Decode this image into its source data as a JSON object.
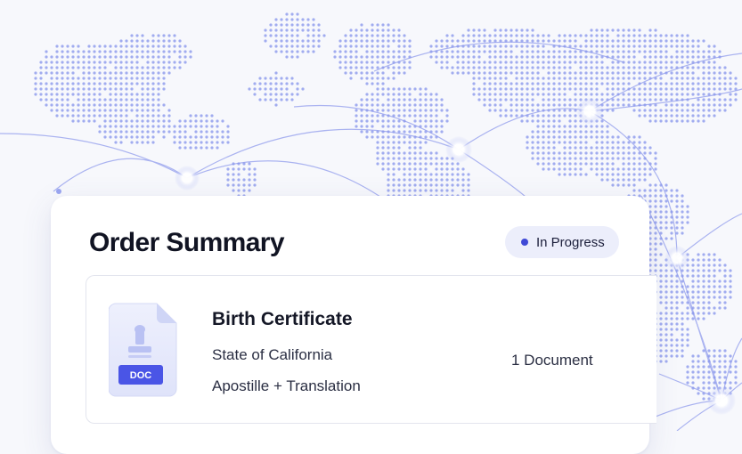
{
  "order_summary": {
    "title": "Order Summary",
    "status": {
      "label": "In Progress",
      "color": "#3f49d6"
    },
    "item": {
      "title": "Birth Certificate",
      "issuer": "State of California",
      "service": "Apostille + Translation",
      "document_count": "1 Document",
      "icon": {
        "name": "document-icon",
        "badge": "DOC",
        "badge_color": "#4a55e6"
      }
    }
  },
  "background": {
    "type": "world-map-network",
    "dot_color": "#5b6fe6",
    "line_color": "#8a96ec"
  }
}
